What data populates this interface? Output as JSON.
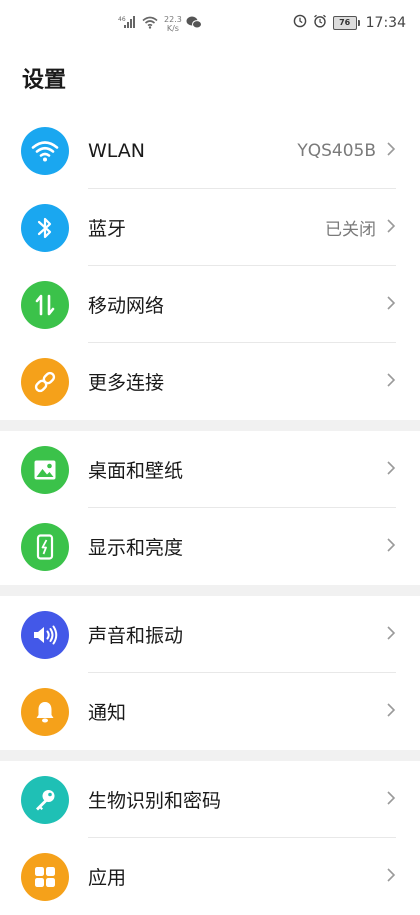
{
  "status_bar": {
    "speed_value": "22.3",
    "speed_unit": "K/s",
    "battery": "76",
    "time": "17:34",
    "icons": [
      "signal-icon",
      "wifi-icon",
      "wechat-icon",
      "battery-saver-icon",
      "alarm-icon",
      "battery-icon"
    ]
  },
  "page_title": "设置",
  "colors": {
    "wlan": "#1aa7f0",
    "bluetooth": "#1aa7f0",
    "mobile_network": "#3bc24a",
    "more_connections": "#f5a11a",
    "wallpaper": "#3bc24a",
    "display": "#3bc24a",
    "sound": "#4358e8",
    "notifications": "#f5a11a",
    "biometrics": "#1fc0b5",
    "apps": "#f5a11a"
  },
  "groups": [
    [
      {
        "key": "wlan",
        "label": "WLAN",
        "value": "YQS405B",
        "icon": "wifi-icon"
      },
      {
        "key": "bluetooth",
        "label": "蓝牙",
        "value": "已关闭",
        "icon": "bluetooth-icon"
      },
      {
        "key": "mobile_network",
        "label": "移动网络",
        "value": "",
        "icon": "mobile-data-icon"
      },
      {
        "key": "more_connections",
        "label": "更多连接",
        "value": "",
        "icon": "link-icon"
      }
    ],
    [
      {
        "key": "wallpaper",
        "label": "桌面和壁纸",
        "value": "",
        "icon": "image-icon"
      },
      {
        "key": "display",
        "label": "显示和亮度",
        "value": "",
        "icon": "brightness-icon"
      }
    ],
    [
      {
        "key": "sound",
        "label": "声音和振动",
        "value": "",
        "icon": "speaker-icon"
      },
      {
        "key": "notifications",
        "label": "通知",
        "value": "",
        "icon": "bell-icon"
      }
    ],
    [
      {
        "key": "biometrics",
        "label": "生物识别和密码",
        "value": "",
        "icon": "key-icon"
      },
      {
        "key": "apps",
        "label": "应用",
        "value": "",
        "icon": "apps-grid-icon"
      }
    ]
  ]
}
